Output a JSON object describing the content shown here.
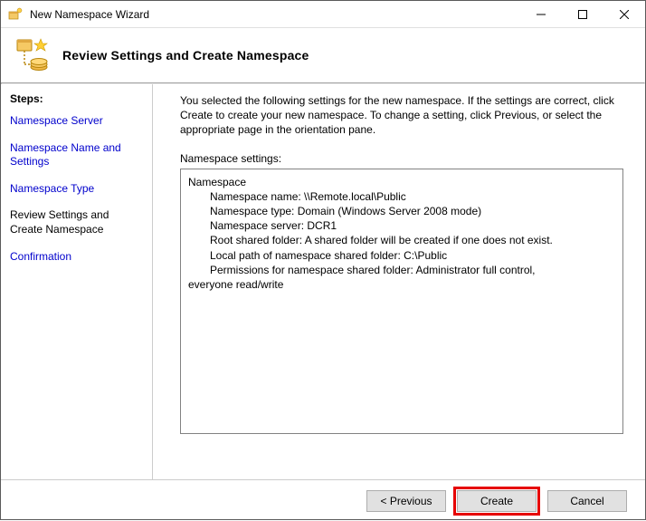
{
  "title": "New Namespace Wizard",
  "header_title": "Review Settings and Create Namespace",
  "sidebar": {
    "steps_label": "Steps:",
    "items": [
      {
        "label": "Namespace Server"
      },
      {
        "label": "Namespace Name and Settings"
      },
      {
        "label": "Namespace Type"
      },
      {
        "label": "Review Settings and Create Namespace"
      },
      {
        "label": "Confirmation"
      }
    ]
  },
  "content": {
    "description": "You selected the following settings for the new namespace. If the settings are correct, click Create to create your new namespace. To change a setting, click Previous, or select the appropriate page in the orientation pane.",
    "settings_label": "Namespace settings:",
    "settings": {
      "heading": "Namespace",
      "lines": {
        "name": "Namespace name: \\\\Remote.local\\Public",
        "type": "Namespace type: Domain (Windows Server 2008 mode)",
        "server": "Namespace server: DCR1",
        "root": "Root shared folder:  A shared folder will be created if one does not exist.",
        "localpath": "Local path of namespace shared folder: C:\\Public",
        "perm1": "Permissions for namespace shared folder: Administrator full control,",
        "perm2": "everyone read/write"
      }
    }
  },
  "buttons": {
    "previous": "< Previous",
    "create": "Create",
    "cancel": "Cancel"
  }
}
